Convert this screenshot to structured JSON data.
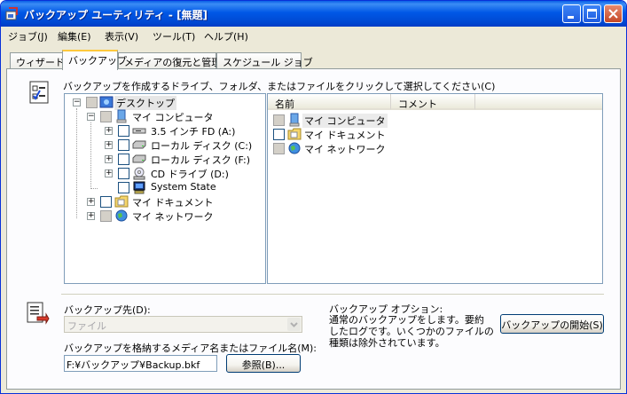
{
  "window": {
    "title": "バックアップ ユーティリティ - [無題]"
  },
  "menu": [
    "ジョブ(J)",
    "編集(E)",
    "表示(V)",
    "ツール(T)",
    "ヘルプ(H)"
  ],
  "tabs": [
    "ウィザード",
    "バックアップ",
    "メディアの復元と管理",
    "スケジュール ジョブ"
  ],
  "active_tab": "バックアップ",
  "instruction": "バックアップを作成するドライブ、フォルダ、またはファイルをクリックして選択してください(C)",
  "tree": {
    "desktop": "デスクトップ",
    "my_computer": "マイ コンピュータ",
    "fd": "3.5 インチ FD (A:)",
    "local_c": "ローカル ディスク (C:)",
    "local_f": "ローカル ディスク (F:)",
    "cd": "CD ドライブ (D:)",
    "system_state": "System State",
    "my_documents": "マイ ドキュメント",
    "my_network": "マイ ネットワーク"
  },
  "list": {
    "columns": [
      "名前",
      "コメント"
    ],
    "items": [
      "マイ コンピュータ",
      "マイ ドキュメント",
      "マイ ネットワーク"
    ]
  },
  "destination": {
    "label": "バックアップ先(D):",
    "value": "ファイル"
  },
  "media": {
    "label": "バックアップを格納するメディア名またはファイル名(M):",
    "value": "F:¥バックアップ¥Backup.bkf"
  },
  "browse_button": "参照(B)...",
  "options": {
    "heading": "バックアップ オプション:",
    "lines": [
      "通常のバックアップをします。要約",
      "したログです。いくつかのファイルの",
      "種類は除外されています。"
    ]
  },
  "start_button": "バックアップの開始(S)"
}
